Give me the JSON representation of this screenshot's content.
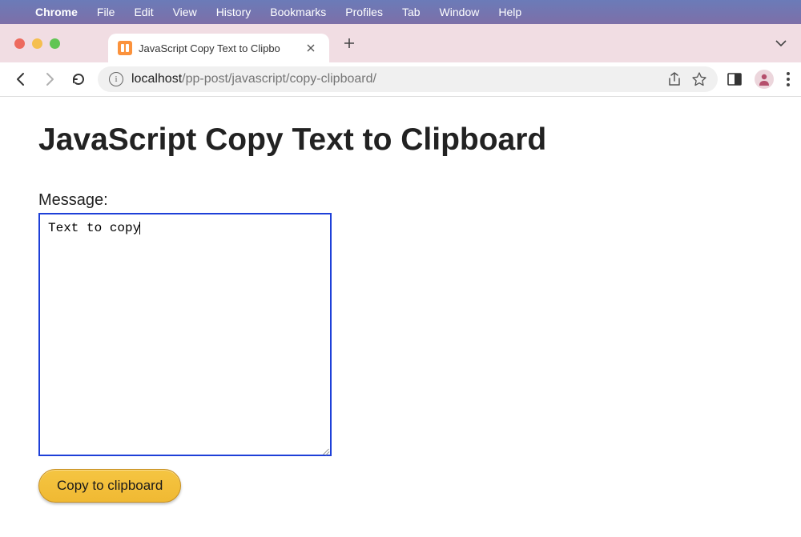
{
  "menubar": {
    "app_name": "Chrome",
    "items": [
      "File",
      "Edit",
      "View",
      "History",
      "Bookmarks",
      "Profiles",
      "Tab",
      "Window",
      "Help"
    ]
  },
  "tab": {
    "title": "JavaScript Copy Text to Clipbo",
    "favicon_glyph": "⌘"
  },
  "addressbar": {
    "host": "localhost",
    "path": "/pp-post/javascript/copy-clipboard/"
  },
  "page": {
    "heading": "JavaScript Copy Text to Clipboard",
    "label": "Message:",
    "textarea_value": "Text to copy",
    "button_label": "Copy to clipboard"
  }
}
